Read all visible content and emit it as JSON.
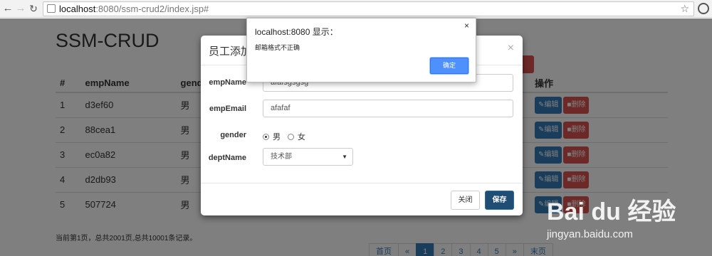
{
  "browser": {
    "url_host": "localhost",
    "url_path": ":8080/ssm-crud2/index.jsp#"
  },
  "page": {
    "title": "SSM-CRUD",
    "table": {
      "headers": [
        "#",
        "empName",
        "gender",
        "操作"
      ],
      "rows": [
        {
          "id": "1",
          "name": "d3ef60",
          "gender": "男"
        },
        {
          "id": "2",
          "name": "88cea1",
          "gender": "男"
        },
        {
          "id": "3",
          "name": "ec0a82",
          "gender": "男"
        },
        {
          "id": "4",
          "name": "d2db93",
          "gender": "男"
        },
        {
          "id": "5",
          "name": "507724",
          "gender": "男"
        }
      ],
      "edit_label": "编辑",
      "delete_label": "删除"
    },
    "page_info": "当前第1页，总共2001页,总共10001条记录。",
    "pagination": [
      "首页",
      "«",
      "1",
      "2",
      "3",
      "4",
      "5",
      "»",
      "末页"
    ],
    "active_page": "1"
  },
  "modal": {
    "title": "员工添加",
    "close": "×",
    "fields": {
      "empName_label": "empName",
      "empName_value": "afafsgsgsg",
      "empEmail_label": "empEmail",
      "empEmail_value": "afafaf",
      "gender_label": "gender",
      "gender_male": "男",
      "gender_female": "女",
      "dept_label": "deptName",
      "dept_value": "技术部"
    },
    "close_button": "关闭",
    "save_button": "保存"
  },
  "alert": {
    "title": "localhost:8080 显示：",
    "close": "×",
    "message": "邮箱格式不正确",
    "ok_button": "确定"
  },
  "watermark": {
    "logo": "Bai du 经验",
    "url": "jingyan.baidu.com"
  }
}
